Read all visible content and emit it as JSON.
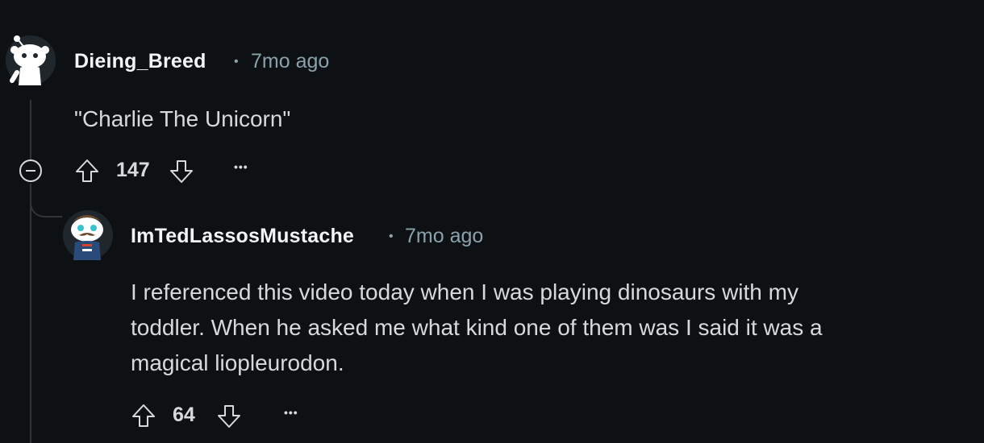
{
  "comments": [
    {
      "username": "Dieing_Breed",
      "separator": "•",
      "timestamp": "7mo ago",
      "body": "\"Charlie The Unicorn\"",
      "score": "147",
      "more_label": "•••"
    },
    {
      "username": "ImTedLassosMustache",
      "separator": "•",
      "timestamp": "7mo ago",
      "body_lines": [
        "I referenced this video today when I was playing dinosaurs with my",
        "toddler. When he asked me what kind one of them was I said it was a",
        "magical liopleurodon."
      ],
      "score": "64",
      "more_label": "•••"
    }
  ],
  "icons": {
    "upvote": "upvote-arrow-icon",
    "downvote": "downvote-arrow-icon",
    "collapse": "collapse-minus-icon",
    "avatar": "snoo-avatar-icon"
  },
  "colors": {
    "background": "#0e1113",
    "text": "#d7dadc",
    "meta": "#8ba2ad",
    "thread_line": "#2f3437"
  }
}
